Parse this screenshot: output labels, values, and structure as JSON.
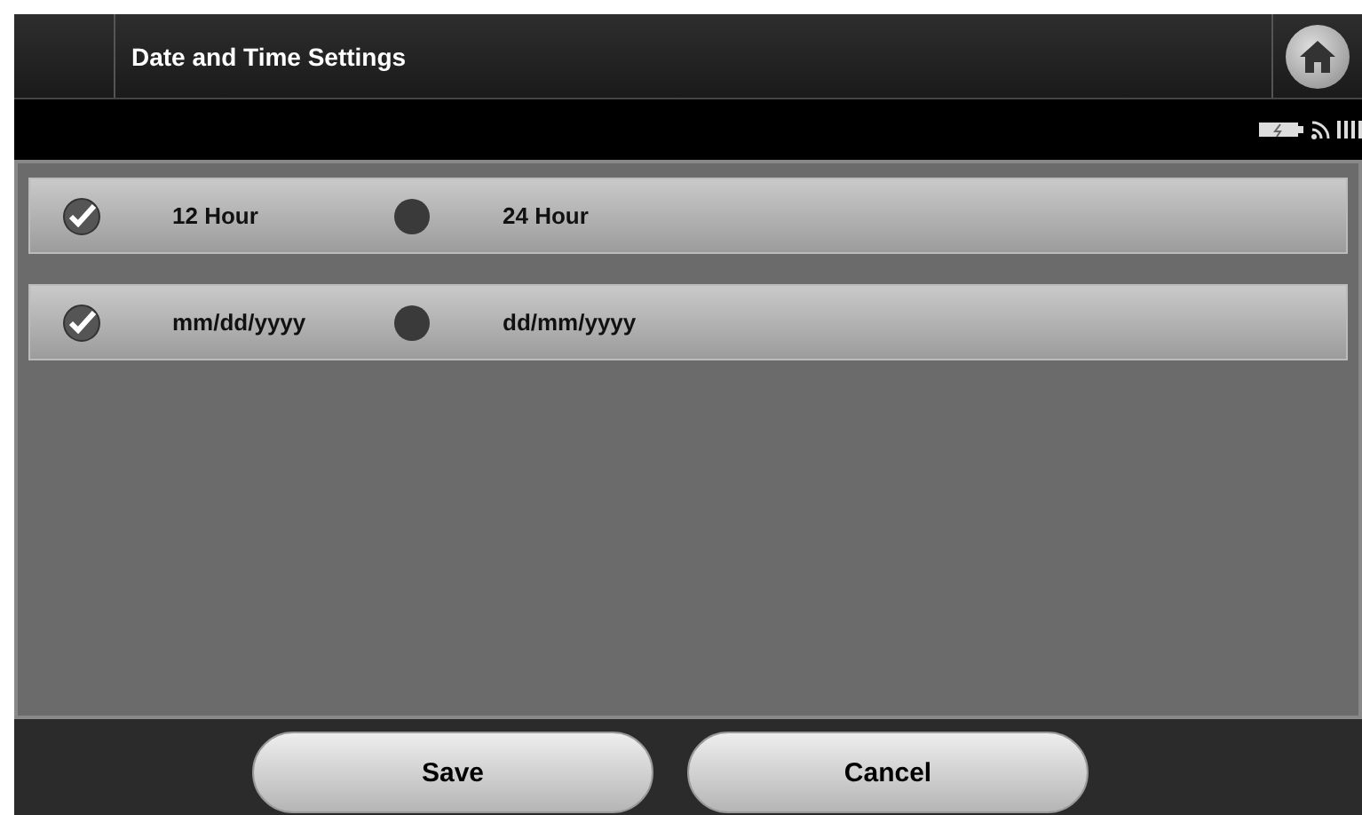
{
  "header": {
    "title": "Date and Time Settings"
  },
  "settings": [
    {
      "options": [
        {
          "label": "12 Hour",
          "selected": true
        },
        {
          "label": "24 Hour",
          "selected": false
        }
      ]
    },
    {
      "options": [
        {
          "label": "mm/dd/yyyy",
          "selected": true
        },
        {
          "label": "dd/mm/yyyy",
          "selected": false
        }
      ]
    }
  ],
  "buttons": [
    "Save",
    "Cancel"
  ]
}
